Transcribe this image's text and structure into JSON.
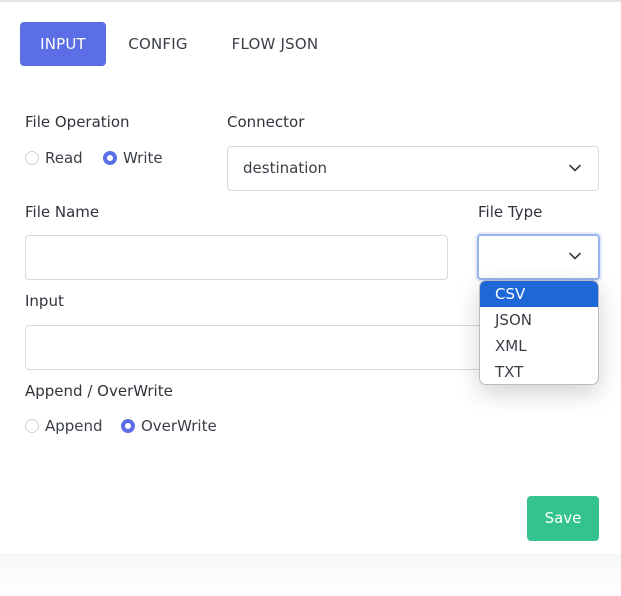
{
  "tabs": [
    {
      "label": "INPUT",
      "active": true
    },
    {
      "label": "CONFIG",
      "active": false
    },
    {
      "label": "FLOW JSON",
      "active": false
    }
  ],
  "file_operation": {
    "label": "File Operation",
    "options": [
      {
        "label": "Read",
        "checked": false
      },
      {
        "label": "Write",
        "checked": true
      }
    ]
  },
  "connector": {
    "label": "Connector",
    "value": "destination"
  },
  "file_name": {
    "label": "File Name",
    "value": ""
  },
  "file_type": {
    "label": "File Type",
    "value": "",
    "options": [
      "CSV",
      "JSON",
      "XML",
      "TXT"
    ],
    "highlighted": "CSV"
  },
  "input": {
    "label": "Input",
    "value": ""
  },
  "append_overwrite": {
    "label": "Append / OverWrite",
    "options": [
      {
        "label": "Append",
        "checked": false
      },
      {
        "label": "OverWrite",
        "checked": true
      }
    ]
  },
  "save_label": "Save",
  "colors": {
    "primary": "#5c6ee6",
    "success": "#34c38f",
    "dropdown_highlight": "#1e67d6"
  }
}
